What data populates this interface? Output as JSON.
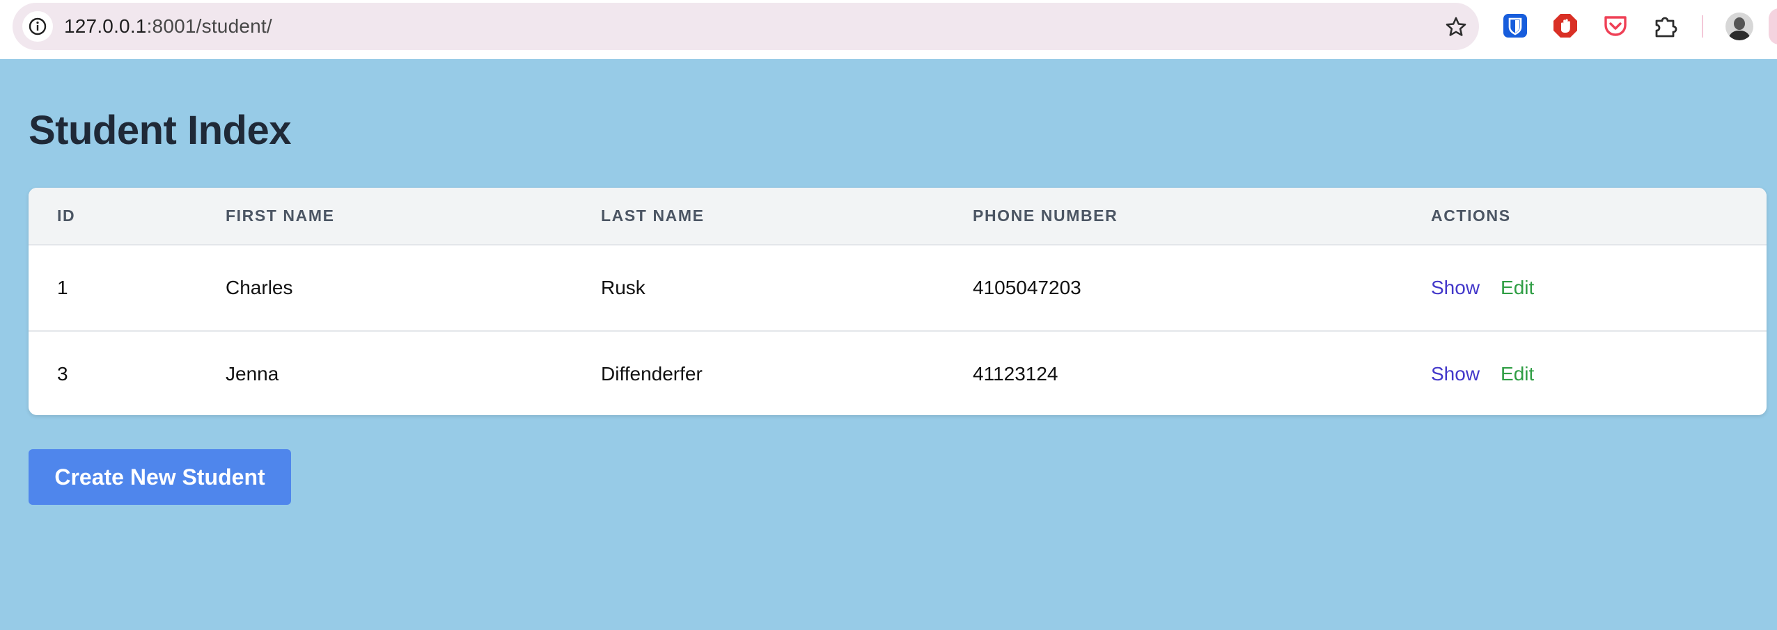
{
  "browser": {
    "url_host": "127.0.0.1",
    "url_path": ":8001/student/",
    "icons": {
      "site_info": "info-icon",
      "bookmark": "star-icon",
      "extensions": [
        "bitwarden-icon",
        "adblock-icon",
        "pocket-icon",
        "puzzle-extensions-icon"
      ],
      "profile": "avatar"
    }
  },
  "page": {
    "title": "Student Index",
    "background_color": "#97cbe7"
  },
  "table": {
    "headers": {
      "id": "ID",
      "first_name": "FIRST NAME",
      "last_name": "LAST NAME",
      "phone": "PHONE NUMBER",
      "actions": "ACTIONS"
    },
    "rows": [
      {
        "id": "1",
        "first_name": "Charles",
        "last_name": "Rusk",
        "phone": "4105047203",
        "show": "Show",
        "edit": "Edit"
      },
      {
        "id": "3",
        "first_name": "Jenna",
        "last_name": "Diffenderfer",
        "phone": "41123124",
        "show": "Show",
        "edit": "Edit"
      }
    ],
    "colors": {
      "show_link": "#4338ca",
      "edit_link": "#2f9e44"
    }
  },
  "create_button": {
    "label": "Create New Student",
    "color": "#4f86ec"
  }
}
